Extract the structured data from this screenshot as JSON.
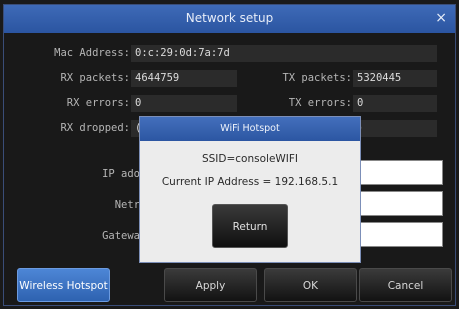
{
  "window": {
    "title": "Network setup",
    "close_glyph": "×",
    "close_icon": "close-icon"
  },
  "info": {
    "mac_label": "Mac Address:",
    "mac_value": "0:c:29:0d:7a:7d",
    "rx_packets_label": "RX packets:",
    "rx_packets_value": "4644759",
    "tx_packets_label": "TX packets:",
    "tx_packets_value": "5320445",
    "rx_errors_label": "RX errors:",
    "rx_errors_value": "0",
    "tx_errors_label": "TX errors:",
    "tx_errors_value": "0",
    "rx_dropped_label": "RX dropped:",
    "rx_dropped_value": "(",
    "tx_dropped_value": ")"
  },
  "form": {
    "ip_label": "IP ado",
    "netmask_label": "Netr",
    "gateway_label": "Gatewa"
  },
  "buttons": {
    "wireless": "Wireless Hotspot",
    "apply": "Apply",
    "ok": "OK",
    "cancel": "Cancel"
  },
  "dialog": {
    "title": "WiFi Hotspot",
    "ssid": "SSID=consoleWIFI",
    "ip": "Current IP Address = 192.168.5.1",
    "return_label": "Return"
  },
  "colors": {
    "titlebar": "#3e6ab7",
    "accent": "#4d86d6",
    "background": "#191919"
  }
}
